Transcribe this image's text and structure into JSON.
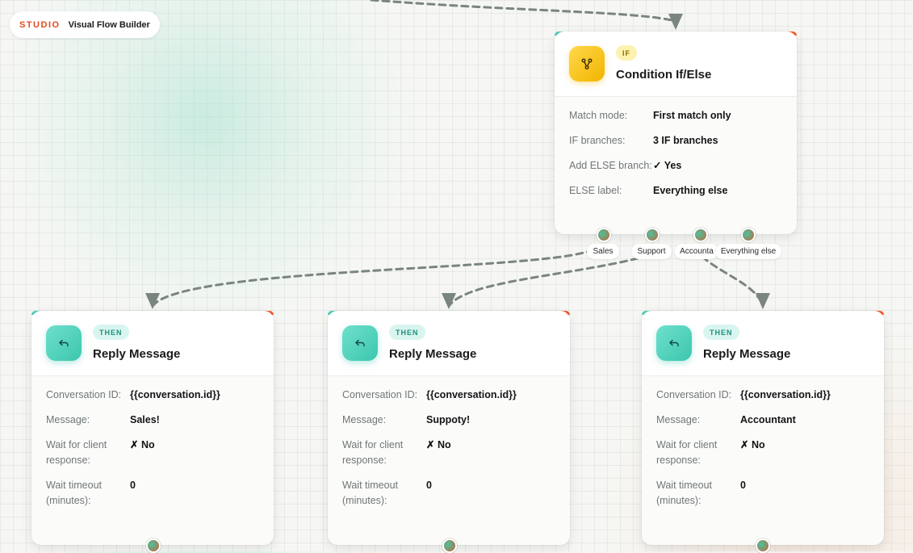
{
  "brand": {
    "mark": "STUDIO",
    "title": "Visual Flow Builder"
  },
  "condition_node": {
    "badge": "IF",
    "title": "Condition If/Else",
    "icon": "branch-icon",
    "fields": [
      {
        "label": "Match mode:",
        "value": "First match only"
      },
      {
        "label": "IF branches:",
        "value": "3 IF branches"
      },
      {
        "label": "Add ELSE branch:",
        "value": "✓ Yes"
      },
      {
        "label": "ELSE label:",
        "value": "Everything else"
      }
    ],
    "outputs": [
      "Sales",
      "Support",
      "Accounta",
      "Everything else"
    ]
  },
  "reply_nodes": [
    {
      "badge": "THEN",
      "title": "Reply Message",
      "icon": "reply-icon",
      "fields": [
        {
          "label": "Conversation ID:",
          "value": "{{conversation.id}}"
        },
        {
          "label": "Message:",
          "value": "Sales!"
        },
        {
          "label": "Wait for client response:",
          "value": "✗ No"
        },
        {
          "label": "Wait timeout (minutes):",
          "value": "0"
        }
      ]
    },
    {
      "badge": "THEN",
      "title": "Reply Message",
      "icon": "reply-icon",
      "fields": [
        {
          "label": "Conversation ID:",
          "value": "{{conversation.id}}"
        },
        {
          "label": "Message:",
          "value": "Suppoty!"
        },
        {
          "label": "Wait for client response:",
          "value": "✗ No"
        },
        {
          "label": "Wait timeout (minutes):",
          "value": "0"
        }
      ]
    },
    {
      "badge": "THEN",
      "title": "Reply Message",
      "icon": "reply-icon",
      "fields": [
        {
          "label": "Conversation ID:",
          "value": "{{conversation.id}}"
        },
        {
          "label": "Message:",
          "value": "Accountant"
        },
        {
          "label": "Wait for client response:",
          "value": "✗ No"
        },
        {
          "label": "Wait timeout (minutes):",
          "value": "0"
        }
      ]
    }
  ],
  "colors": {
    "accent_teal": "#4cc8b5",
    "accent_orange": "#f2552a",
    "brand_red": "#e34a1e",
    "edge": "#7b8580"
  }
}
